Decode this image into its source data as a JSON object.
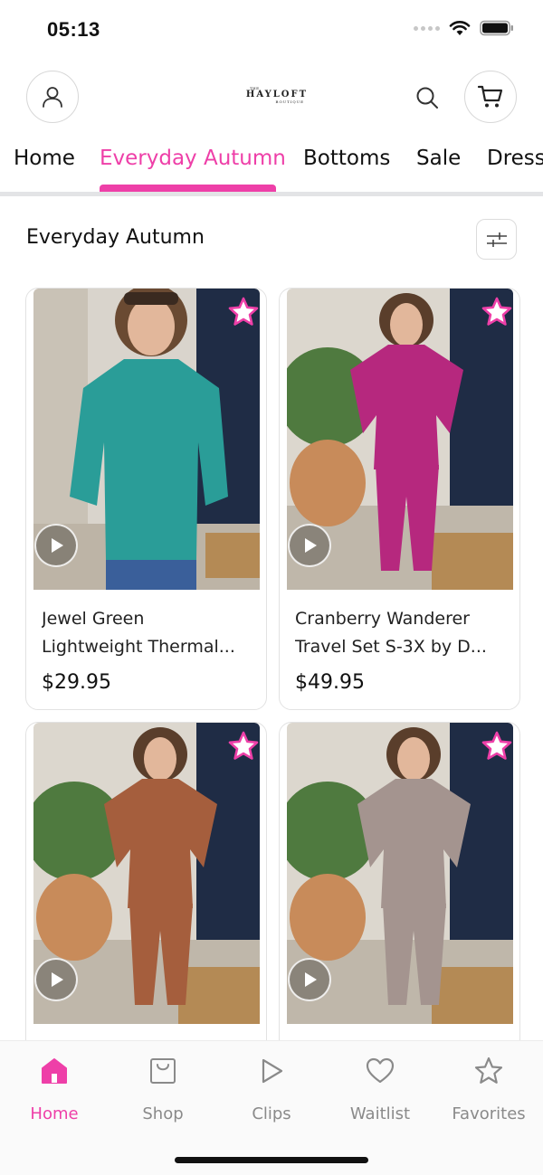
{
  "status_bar": {
    "time": "05:13"
  },
  "header": {
    "logo": {
      "the": "THE",
      "name": "HAYLOFT",
      "sub": "BOUTIQUE"
    },
    "profile_icon": "person-icon",
    "search_icon": "search-icon",
    "cart_icon": "cart-icon"
  },
  "tabs": [
    {
      "label": "Home",
      "active": false
    },
    {
      "label": "Everyday Autumn",
      "active": true
    },
    {
      "label": "Bottoms",
      "active": false
    },
    {
      "label": "Sale",
      "active": false
    },
    {
      "label": "Dress",
      "active": false
    }
  ],
  "section": {
    "title": "Everyday Autumn",
    "filter_icon": "sliders-icon"
  },
  "products": [
    {
      "name_line1": "Jewel Green",
      "name_line2": "Lightweight Thermal...",
      "price": "$29.95",
      "color": "#2a9d98",
      "favorite": true,
      "video": true
    },
    {
      "name_line1": "Cranberry Wanderer",
      "name_line2": "Travel Set S-3X by D...",
      "price": "$49.95",
      "color": "#b6287e",
      "favorite": true,
      "video": true
    },
    {
      "name_line1": "",
      "name_line2": "",
      "price": "",
      "color": "#a55e3d",
      "favorite": true,
      "video": true
    },
    {
      "name_line1": "",
      "name_line2": "",
      "price": "",
      "color": "#a4948f",
      "favorite": true,
      "video": true
    }
  ],
  "bottom_nav": [
    {
      "label": "Home",
      "icon": "house-icon",
      "active": true
    },
    {
      "label": "Shop",
      "icon": "bag-icon",
      "active": false
    },
    {
      "label": "Clips",
      "icon": "play-icon",
      "active": false
    },
    {
      "label": "Waitlist",
      "icon": "heart-icon",
      "active": false
    },
    {
      "label": "Favorites",
      "icon": "star-icon",
      "active": false
    }
  ],
  "colors": {
    "accent": "#ee3fa8",
    "divider": "#e3e4e6",
    "nav_inactive": "#8a8a8a"
  }
}
